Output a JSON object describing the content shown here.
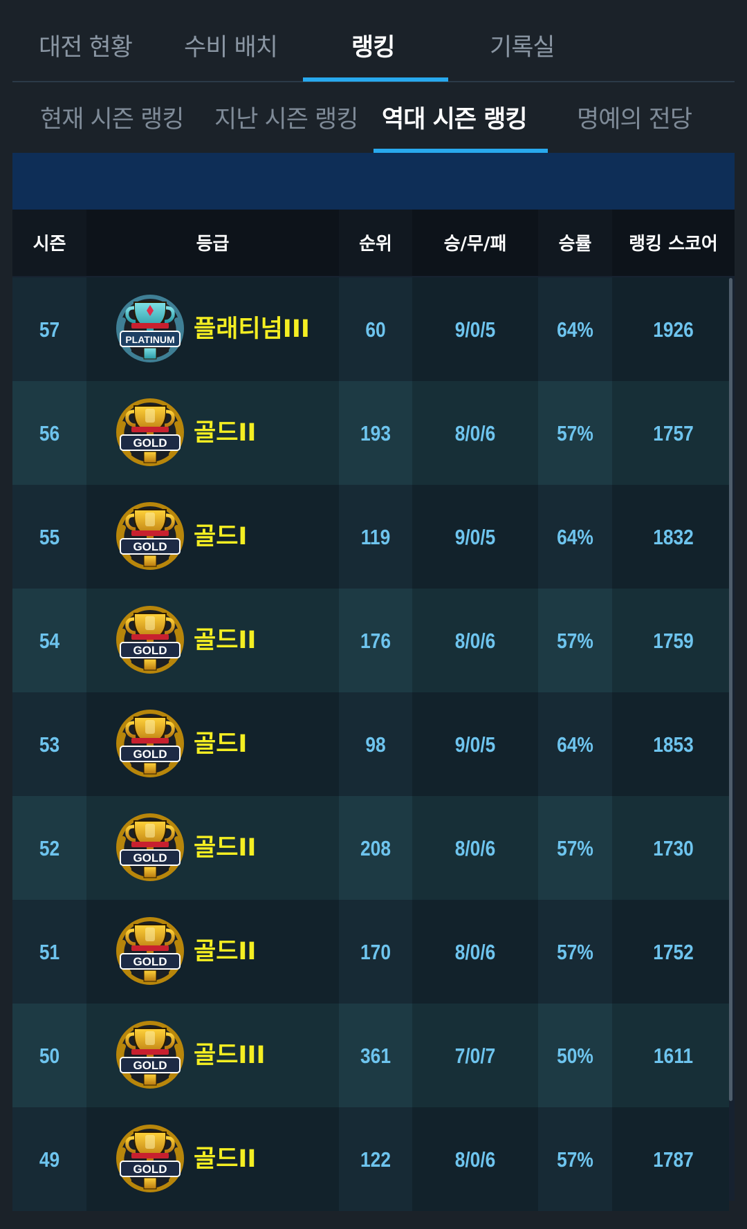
{
  "main_tabs": [
    "대전 현황",
    "수비 배치",
    "랭킹",
    "기록실"
  ],
  "main_tab_active": 2,
  "sub_tabs": [
    "현재 시즌 랭킹",
    "지난 시즌 랭킹",
    "역대 시즌 랭킹",
    "명예의 전당"
  ],
  "sub_tab_active": 2,
  "table": {
    "headers": [
      "시즌",
      "등급",
      "순위",
      "승/무/패",
      "승률",
      "랭킹 스코어"
    ],
    "rows": [
      {
        "season": "57",
        "tier": "platinum",
        "badge_text": "PLATINUM",
        "grade": "플래티넘III",
        "rank": "60",
        "record": "9/0/5",
        "win_rate": "64%",
        "score": "1926"
      },
      {
        "season": "56",
        "tier": "gold",
        "badge_text": "GOLD",
        "grade": "골드II",
        "rank": "193",
        "record": "8/0/6",
        "win_rate": "57%",
        "score": "1757"
      },
      {
        "season": "55",
        "tier": "gold",
        "badge_text": "GOLD",
        "grade": "골드I",
        "rank": "119",
        "record": "9/0/5",
        "win_rate": "64%",
        "score": "1832"
      },
      {
        "season": "54",
        "tier": "gold",
        "badge_text": "GOLD",
        "grade": "골드II",
        "rank": "176",
        "record": "8/0/6",
        "win_rate": "57%",
        "score": "1759"
      },
      {
        "season": "53",
        "tier": "gold",
        "badge_text": "GOLD",
        "grade": "골드I",
        "rank": "98",
        "record": "9/0/5",
        "win_rate": "64%",
        "score": "1853"
      },
      {
        "season": "52",
        "tier": "gold",
        "badge_text": "GOLD",
        "grade": "골드II",
        "rank": "208",
        "record": "8/0/6",
        "win_rate": "57%",
        "score": "1730"
      },
      {
        "season": "51",
        "tier": "gold",
        "badge_text": "GOLD",
        "grade": "골드II",
        "rank": "170",
        "record": "8/0/6",
        "win_rate": "57%",
        "score": "1752"
      },
      {
        "season": "50",
        "tier": "gold",
        "badge_text": "GOLD",
        "grade": "골드III",
        "rank": "361",
        "record": "7/0/7",
        "win_rate": "50%",
        "score": "1611"
      },
      {
        "season": "49",
        "tier": "gold",
        "badge_text": "GOLD",
        "grade": "골드II",
        "rank": "122",
        "record": "8/0/6",
        "win_rate": "57%",
        "score": "1787"
      }
    ]
  },
  "colors": {
    "accent": "#28a9ee",
    "grade_text": "#f4ee22",
    "value_text": "#6ec4ee",
    "banner": "#0e2e57"
  }
}
